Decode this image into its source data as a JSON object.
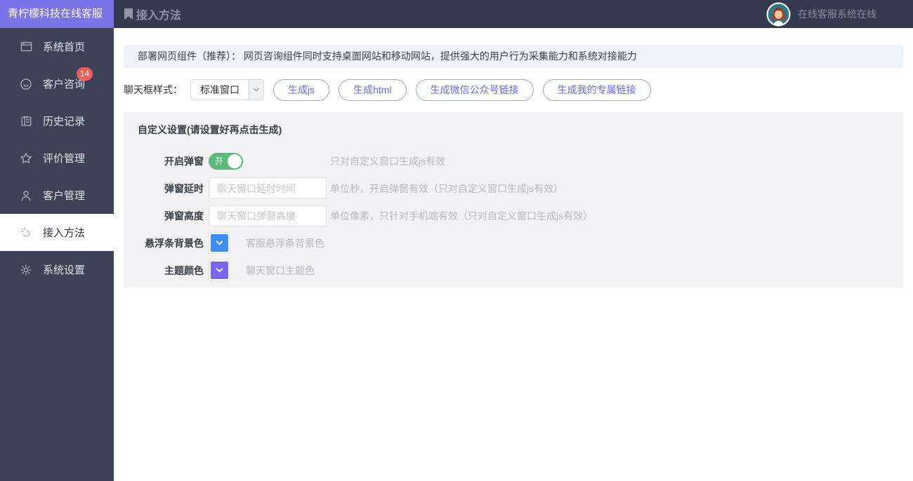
{
  "app": {
    "logo_text": "青柠檬科技在线客服"
  },
  "header": {
    "page_title": "接入方法",
    "status_text": "在线客服系统在线"
  },
  "sidebar": {
    "items": [
      {
        "label": "系统首页",
        "icon": "window-icon"
      },
      {
        "label": "客户咨询",
        "icon": "chat-smile-icon",
        "badge": "14"
      },
      {
        "label": "历史记录",
        "icon": "history-notes-icon"
      },
      {
        "label": "评价管理",
        "icon": "star-icon"
      },
      {
        "label": "客户管理",
        "icon": "user-icon"
      },
      {
        "label": "接入方法",
        "icon": "link-spark-icon",
        "active": true
      },
      {
        "label": "系统设置",
        "icon": "gear-icon"
      }
    ]
  },
  "main": {
    "banner_text": "部署网页组件（推荐）： 网页咨询组件同时支持桌面网站和移动网站，提供强大的用户行为采集能力和系统对接能力",
    "style_row": {
      "label": "聊天框样式：",
      "select_value": "标准窗口",
      "buttons": [
        "生成js",
        "生成html",
        "生成微信公众号链接",
        "生成我的专属链接"
      ]
    },
    "panel": {
      "title": "自定义设置(请设置好再点击生成)",
      "popup_row": {
        "label": "开启弹窗",
        "toggle_state": "on",
        "toggle_on_text": "开",
        "hint": "只对自定义窗口生成js有效"
      },
      "delay_row": {
        "label": "弹窗延时",
        "value": "",
        "placeholder": "聊天窗口延时时间",
        "hint": "单位秒，开启弹窗有效（只对自定义窗口生成js有效）"
      },
      "height_row": {
        "label": "弹窗高度",
        "value": "",
        "placeholder": "聊天窗口弹窗高度",
        "hint": "单位像素，只针对手机端有效（只对自定义窗口生成js有效）"
      },
      "floatbar_color_row": {
        "label": "悬浮条背景色",
        "color": "#3d8ef0",
        "hint": "客服悬浮条背景色"
      },
      "theme_color_row": {
        "label": "主题颜色",
        "color": "#7a66f0",
        "hint": "聊天窗口主题色"
      }
    }
  },
  "colors": {
    "accent_purple": "#7b74e8",
    "sidebar_bg": "#3d4356",
    "header_bg": "#343a4f",
    "badge_red": "#f35b5b",
    "toggle_green": "#5cb87c",
    "pill_text": "#6d6af0"
  }
}
